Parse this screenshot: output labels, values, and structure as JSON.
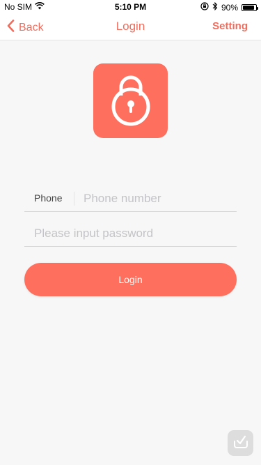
{
  "status_bar": {
    "carrier": "No SIM",
    "time": "5:10 PM",
    "battery_percent": "90%",
    "battery_level": 0.9,
    "icons": [
      "wifi-icon",
      "rotation-lock-icon",
      "bluetooth-icon",
      "battery-icon"
    ]
  },
  "nav": {
    "back_label": "Back",
    "title": "Login",
    "setting_label": "Setting"
  },
  "logo": {
    "icon": "lock-icon"
  },
  "form": {
    "phone_label": "Phone",
    "phone_placeholder": "Phone number",
    "phone_value": "",
    "password_placeholder": "Please input password",
    "password_value": "",
    "login_label": "Login"
  },
  "colors": {
    "accent": "#ff6f5e",
    "nav_text": "#f06d5d",
    "background": "#f7f7f7"
  }
}
